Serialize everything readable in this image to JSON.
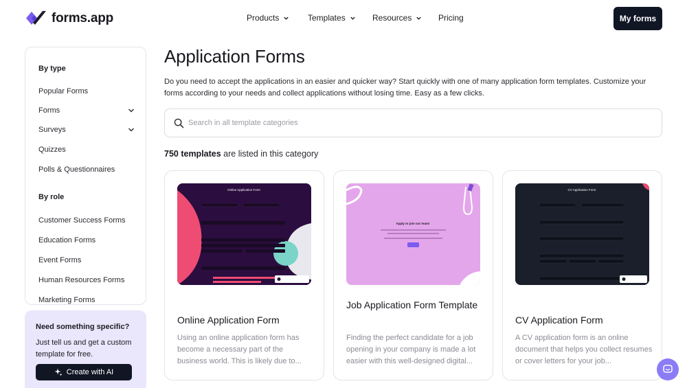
{
  "brand": {
    "name": "forms.app"
  },
  "nav": {
    "items": [
      {
        "label": "Products",
        "has_dropdown": true
      },
      {
        "label": "Templates",
        "has_dropdown": true
      },
      {
        "label": "Resources",
        "has_dropdown": true
      },
      {
        "label": "Pricing",
        "has_dropdown": false
      }
    ],
    "cta": "My forms"
  },
  "sidebar": {
    "by_type_heading": "By type",
    "by_type": [
      {
        "label": "Popular Forms",
        "expandable": false
      },
      {
        "label": "Forms",
        "expandable": true
      },
      {
        "label": "Surveys",
        "expandable": true
      },
      {
        "label": "Quizzes",
        "expandable": false
      },
      {
        "label": "Polls & Questionnaires",
        "expandable": false
      }
    ],
    "by_role_heading": "By role",
    "by_role": [
      {
        "label": "Customer Success Forms"
      },
      {
        "label": "Education Forms"
      },
      {
        "label": "Event Forms"
      },
      {
        "label": "Human Resources Forms"
      },
      {
        "label": "Marketing Forms"
      }
    ]
  },
  "promo": {
    "title": "Need something specific?",
    "text": "Just tell us and get a custom template for free.",
    "button": "Create with AI"
  },
  "main": {
    "title": "Application Forms",
    "description": "Do you need to accept the applications in an easier and quicker way? Start quickly with one of many application form templates. Customize your forms according to your needs and collect applications without losing time. Easy as a few clicks.",
    "search_placeholder": "Search in all template categories",
    "count_number": "750 templates",
    "count_rest": " are listed in this category"
  },
  "cards": [
    {
      "title": "Online Application Form",
      "description": "Using an online application form has become a necessary part of the business world. This is likely due to...",
      "thumb_heading": "Online Application Form",
      "thumb_color": "#2c0d3f"
    },
    {
      "title": "Job Application Form Template",
      "description": "Finding the perfect candidate for a job opening in your company is made a lot easier with this well-designed digital...",
      "thumb_heading": "Apply to join our team!",
      "thumb_color": "#e4a6ea"
    },
    {
      "title": "CV Application Form",
      "description": "A CV application form is an online document that helps you collect resumes or cover letters for your job...",
      "thumb_heading": "CV Application Form",
      "thumb_color": "#1a1f2b"
    }
  ],
  "colors": {
    "primary_dark": "#101624",
    "accent_purple": "#8b7cf6",
    "promo_bg": "#eae6fb"
  }
}
